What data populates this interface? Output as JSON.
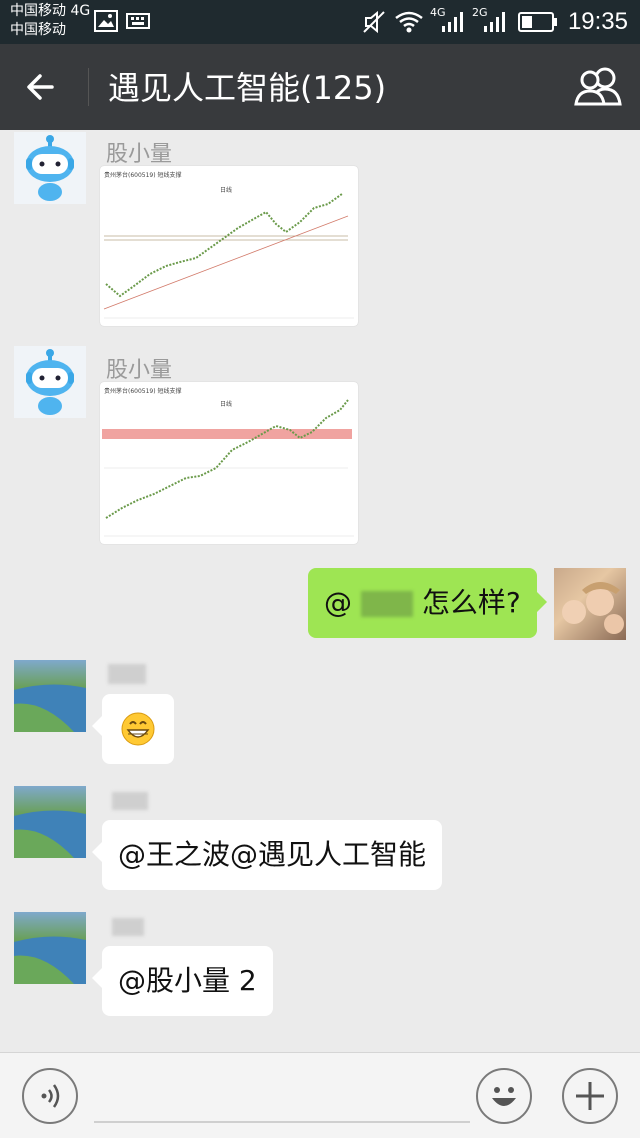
{
  "status_bar": {
    "carrier_1": "中国移动 4G",
    "carrier_2": "中国移动",
    "network_1": "4G",
    "network_2": "2G",
    "time": "19:35"
  },
  "header": {
    "title": "遇见人工智能(125)"
  },
  "messages": [
    {
      "sender": "股小量",
      "type": "image",
      "chart_data": {
        "type": "line",
        "title": "日线",
        "legend_text": "贵州茅台(600519) 短线支撑"
      }
    },
    {
      "sender": "股小量",
      "type": "image",
      "chart_data": {
        "type": "line",
        "title": "日线",
        "legend_text": "贵州茅台(600519) 短线支撑"
      }
    },
    {
      "sender": "me",
      "type": "text",
      "prefix": "@",
      "text": "怎么样?"
    },
    {
      "type": "emoji",
      "icon": "grin-emoji-icon"
    },
    {
      "type": "text",
      "text": "@王之波@遇见人工智能"
    },
    {
      "type": "text",
      "text": "@股小量 2"
    }
  ],
  "input_bar": {
    "placeholder": "",
    "icons": [
      "voice-icon",
      "emoji-icon",
      "plus-icon"
    ]
  },
  "colors": {
    "header_bg": "#383a3d",
    "status_bg": "#1f2a2f",
    "chat_bg": "#ebebeb",
    "own_bubble": "#9ee553"
  }
}
